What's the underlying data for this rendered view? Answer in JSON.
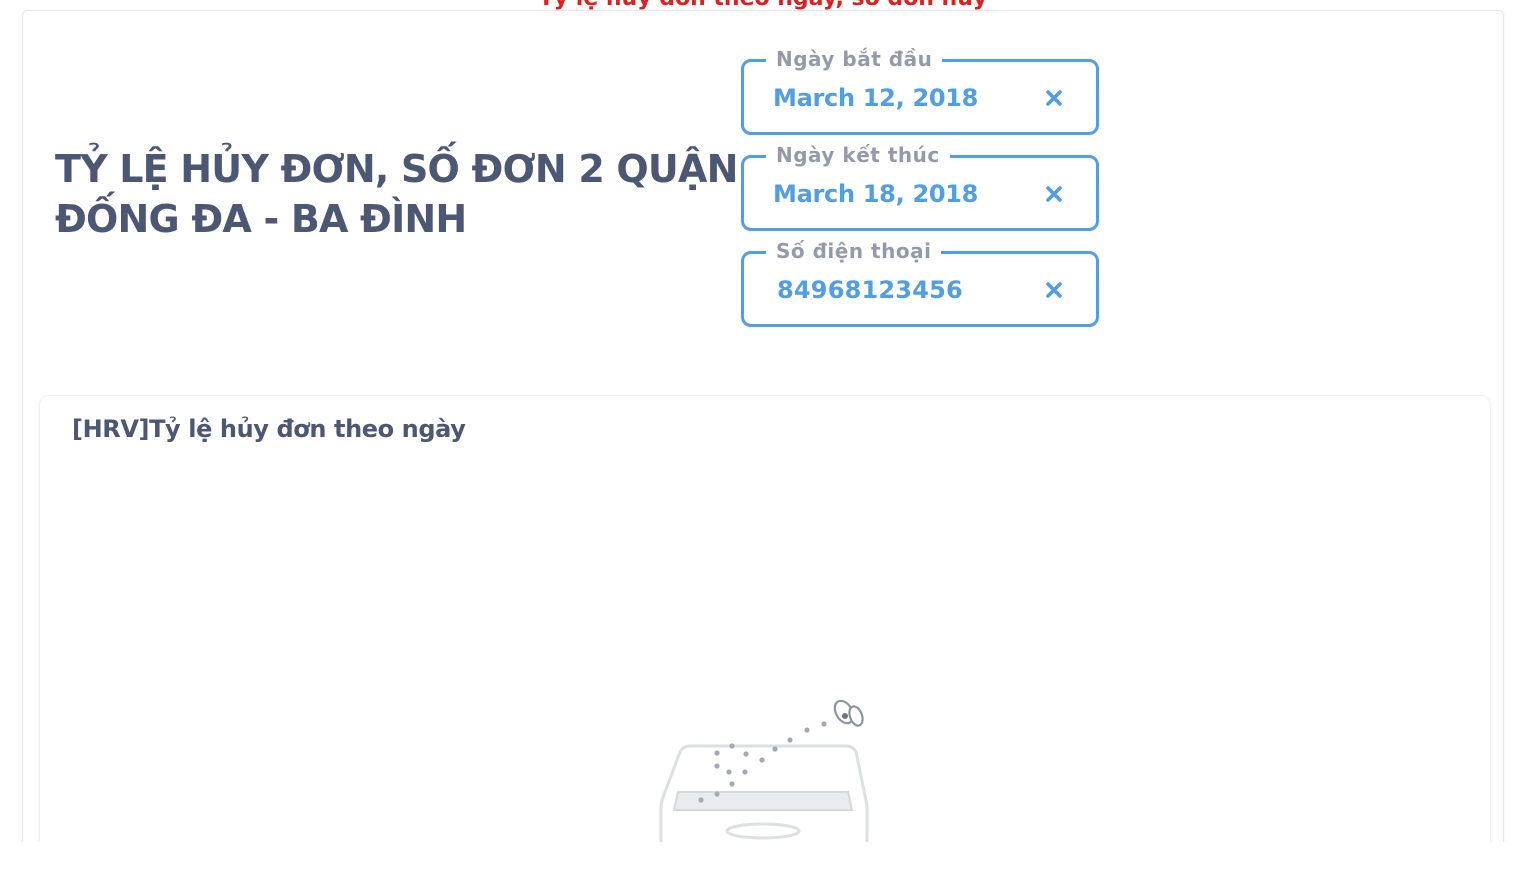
{
  "banner": {
    "text": "Tỷ lệ hủy đơn theo ngày, số đơn hủy"
  },
  "dashboard": {
    "title": "TỶ LỆ HỦY ĐƠN, SỐ ĐƠN 2 QUẬN ĐỐNG ĐA - BA ĐÌNH"
  },
  "filters": [
    {
      "label": "Ngày bắt đầu",
      "value": "March 12, 2018",
      "clear_icon": "close-icon"
    },
    {
      "label": "Ngày kết thúc",
      "value": "March 18, 2018",
      "clear_icon": "close-icon"
    },
    {
      "label": "Số điện thoại",
      "value": "84968123456",
      "clear_icon": "close-icon"
    }
  ],
  "card": {
    "title": "[HRV]Tỷ lệ hủy đơn theo ngày",
    "empty_state_icon": "empty-box-illustration"
  },
  "colors": {
    "accent": "#509ee3",
    "title_text": "#4c5773",
    "label_text": "#949aab",
    "banner_text": "#e02020"
  }
}
